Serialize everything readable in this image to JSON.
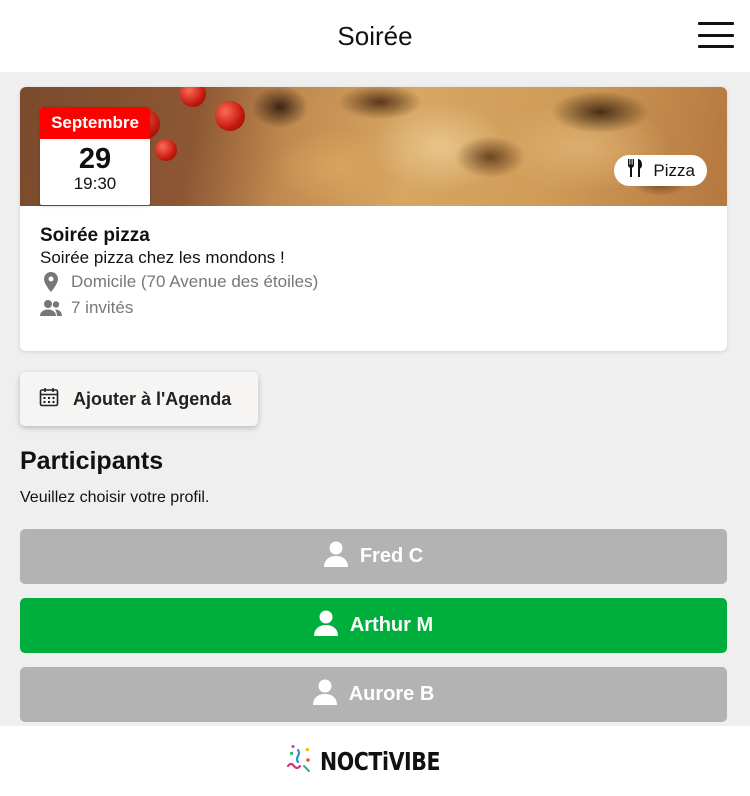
{
  "header": {
    "title": "Soirée",
    "menu_icon": "hamburger-menu-icon"
  },
  "event": {
    "date": {
      "month": "Septembre",
      "day": "29",
      "time": "19:30"
    },
    "category": {
      "label": "Pizza",
      "icon": "fork-knife-icon"
    },
    "title": "Soirée pizza",
    "description": "Soirée pizza chez les mondons !",
    "location": {
      "text": "Domicile (70 Avenue des étoiles)",
      "icon": "location-pin-icon"
    },
    "guests": {
      "text": "7 invités",
      "icon": "users-icon"
    }
  },
  "agenda_button": {
    "label": "Ajouter à l'Agenda",
    "icon": "calendar-icon"
  },
  "participants": {
    "title": "Participants",
    "subtitle": "Veuillez choisir votre profil.",
    "items": [
      {
        "name": "Fred C",
        "selected": false,
        "icon": "user-icon"
      },
      {
        "name": "Arthur M",
        "selected": true,
        "icon": "user-icon"
      },
      {
        "name": "Aurore B",
        "selected": false,
        "icon": "user-icon"
      }
    ]
  },
  "footer": {
    "logo": "NOCTiVIBE"
  },
  "colors": {
    "month_badge": "#ff0000",
    "selected": "#00ae3b",
    "unselected": "#b3b3b3",
    "background": "#efefef"
  }
}
